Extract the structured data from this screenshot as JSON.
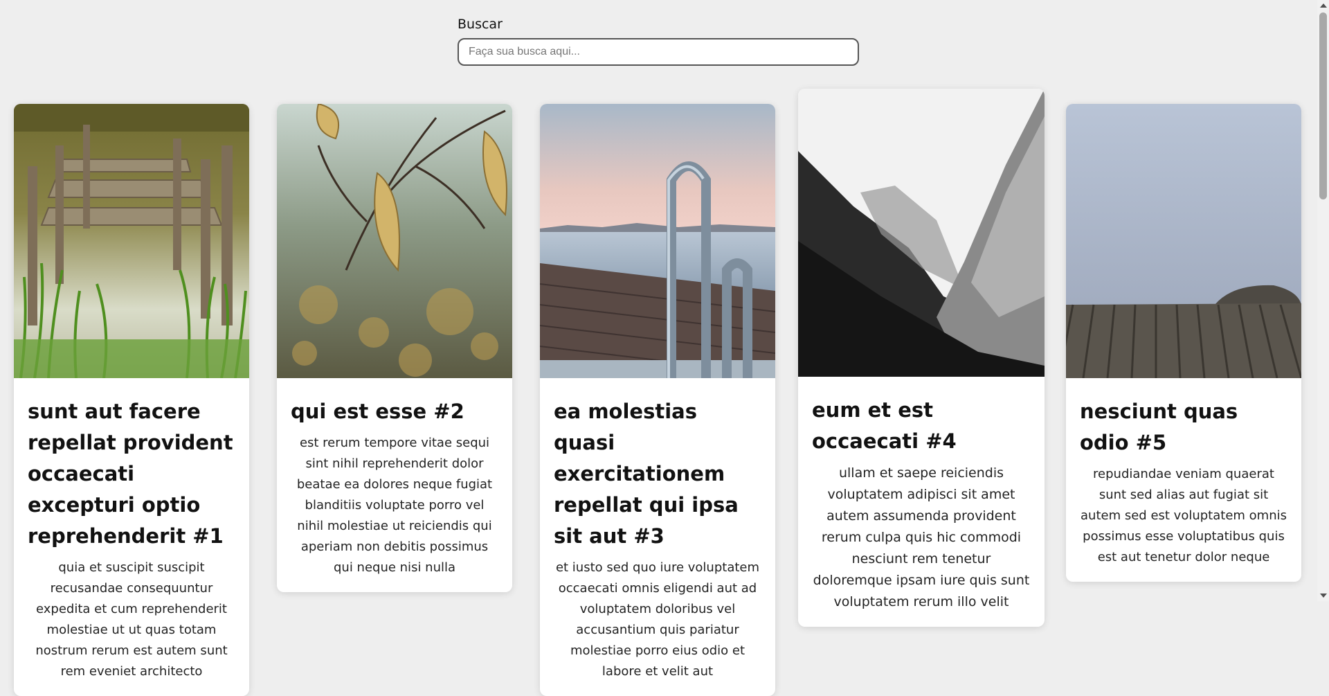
{
  "search": {
    "label": "Buscar",
    "placeholder": "Faça sua busca aqui...",
    "value": ""
  },
  "cards": [
    {
      "title": "sunt aut facere repellat provident occaecati excepturi optio reprehenderit #1",
      "body": "quia et suscipit suscipit recusandae consequuntur expedita et cum reprehenderit molestiae ut ut quas totam nostrum rerum est autem sunt rem eveniet architecto",
      "image": "wooden-dock-grass-photo"
    },
    {
      "title": "qui est esse #2",
      "body": "est rerum tempore vitae sequi sint nihil reprehenderit dolor beatae ea dolores neque fugiat blanditiis voluptate porro vel nihil molestiae ut reiciendis qui aperiam non debitis possimus qui neque nisi nulla",
      "image": "autumn-leaves-branch-photo"
    },
    {
      "title": "ea molestias quasi exercitationem repellat qui ipsa sit aut #3",
      "body": "et iusto sed quo iure voluptatem occaecati omnis eligendi aut ad voluptatem doloribus vel accusantium quis pariatur molestiae porro eius odio et labore et velit aut",
      "image": "pier-ladder-lake-photo"
    },
    {
      "title": "eum et est occaecati #4",
      "body": "ullam et saepe reiciendis voluptatem adipisci sit amet autem assumenda provident rerum culpa quis hic commodi nesciunt rem tenetur doloremque ipsam iure quis sunt voluptatem rerum illo velit",
      "image": "misty-mountains-bw-photo"
    },
    {
      "title": "nesciunt quas odio #5",
      "body": "repudiandae veniam quaerat sunt sed alias aut fugiat sit autem sed est voluptatem omnis possimus esse voluptatibus quis est aut tenetur dolor neque",
      "image": "foggy-wooden-deck-photo"
    }
  ]
}
